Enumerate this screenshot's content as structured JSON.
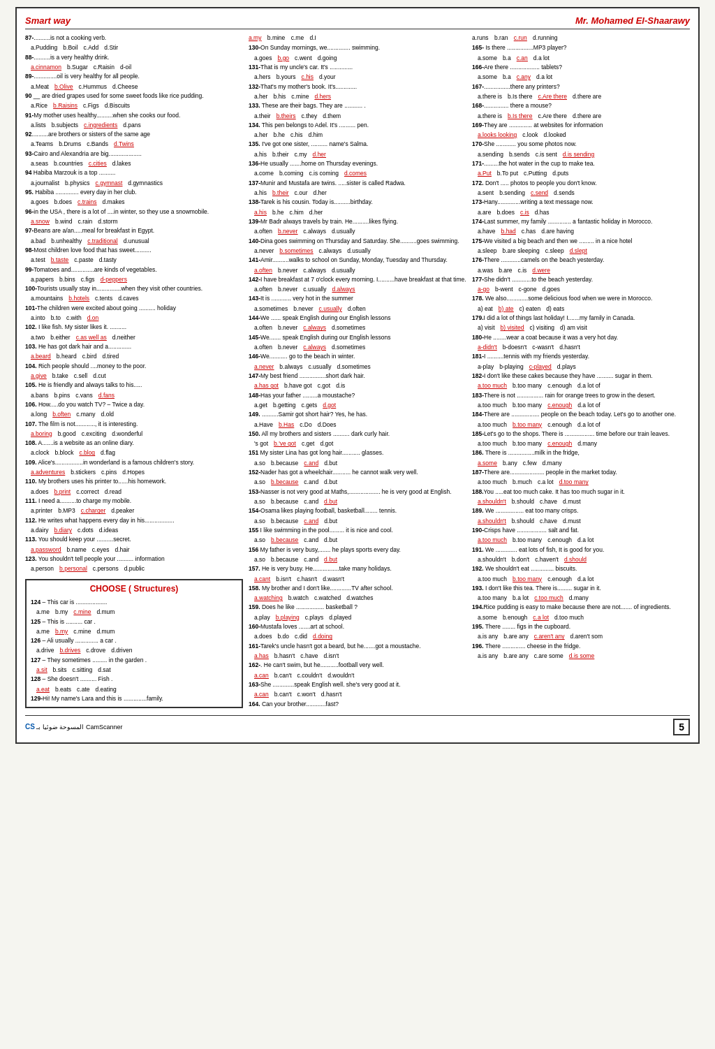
{
  "header": {
    "left": "Smart way",
    "right": "Mr. Mohamed El-Shaarawy"
  },
  "footer": {
    "scanner": "المسوحة ضوئيا بـ CamScanner",
    "page": "5"
  },
  "col1_title": "CHOOSE ( Structures)",
  "col1_section_start": 124
}
